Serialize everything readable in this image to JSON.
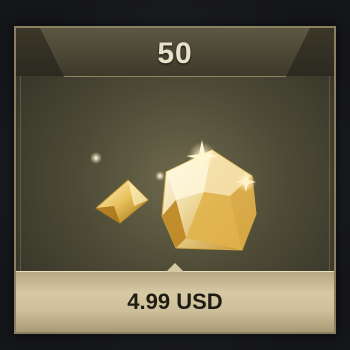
{
  "offer": {
    "quantity": "50",
    "price": "4.99 USD",
    "item_icon": "gold-diamond-pile-icon"
  },
  "colors": {
    "frame": "#8a7f63",
    "panel": "#4d4a36",
    "footer": "#d7c9a4",
    "quantity_text": "#e9e0c8",
    "price_text": "#1f1c14"
  }
}
